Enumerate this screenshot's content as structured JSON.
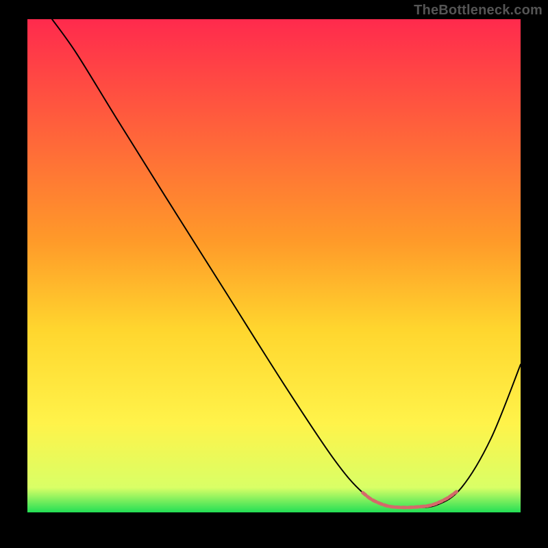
{
  "watermark": "TheBottleneck.com",
  "chart_data": {
    "type": "line",
    "title": "",
    "xlabel": "",
    "ylabel": "",
    "xlim": [
      0,
      100
    ],
    "ylim": [
      0,
      100
    ],
    "background_gradient": {
      "stops": [
        {
          "offset": 0,
          "color": "#ff2a4d"
        },
        {
          "offset": 45,
          "color": "#ff9a29"
        },
        {
          "offset": 63,
          "color": "#ffd62e"
        },
        {
          "offset": 82,
          "color": "#fff34a"
        },
        {
          "offset": 95,
          "color": "#d9ff66"
        },
        {
          "offset": 100,
          "color": "#23df55"
        }
      ]
    },
    "series": [
      {
        "name": "bottleneck-curve",
        "color": "#000000",
        "width": 2,
        "points": [
          {
            "x": 5,
            "y": 100
          },
          {
            "x": 10,
            "y": 93
          },
          {
            "x": 18,
            "y": 80
          },
          {
            "x": 28,
            "y": 64
          },
          {
            "x": 40,
            "y": 45
          },
          {
            "x": 52,
            "y": 26
          },
          {
            "x": 62,
            "y": 11
          },
          {
            "x": 68,
            "y": 4
          },
          {
            "x": 73,
            "y": 1.3
          },
          {
            "x": 78,
            "y": 1
          },
          {
            "x": 83,
            "y": 1.5
          },
          {
            "x": 88,
            "y": 5
          },
          {
            "x": 94,
            "y": 15
          },
          {
            "x": 100,
            "y": 30
          }
        ]
      },
      {
        "name": "optimal-marker",
        "color": "#d46a6a",
        "width": 5,
        "dash": "6 3",
        "points": [
          {
            "x": 68,
            "y": 4
          },
          {
            "x": 70,
            "y": 2.5
          },
          {
            "x": 73,
            "y": 1.3
          },
          {
            "x": 76,
            "y": 1
          },
          {
            "x": 79,
            "y": 1.1
          },
          {
            "x": 82,
            "y": 1.5
          },
          {
            "x": 85,
            "y": 2.8
          },
          {
            "x": 87,
            "y": 4.2
          }
        ]
      }
    ]
  }
}
